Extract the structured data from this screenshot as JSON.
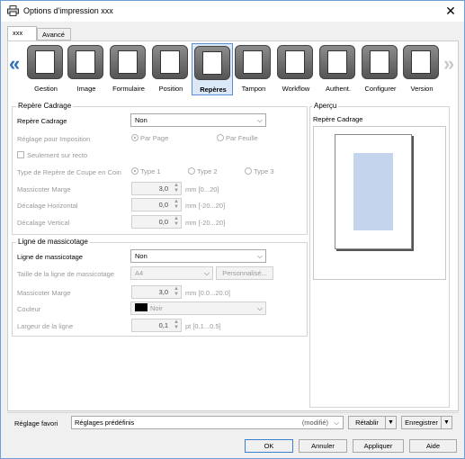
{
  "window": {
    "title": "Options d'impression xxx"
  },
  "tabs": [
    "xxx",
    "Avancé"
  ],
  "ribbon": [
    {
      "label": "Gestion",
      "icon": "gestion-icon"
    },
    {
      "label": "Image",
      "icon": "image-icon"
    },
    {
      "label": "Formulaire",
      "icon": "formulaire-icon"
    },
    {
      "label": "Position",
      "icon": "position-icon"
    },
    {
      "label": "Repères",
      "icon": "reperes-icon",
      "selected": true
    },
    {
      "label": "Tampon",
      "icon": "tampon-icon"
    },
    {
      "label": "Workflow",
      "icon": "workflow-icon"
    },
    {
      "label": "Authent.",
      "icon": "authent-icon"
    },
    {
      "label": "Configurer",
      "icon": "configurer-icon"
    },
    {
      "label": "Version",
      "icon": "version-icon"
    }
  ],
  "repere": {
    "section_title": "Repère Cadrage",
    "repere_label": "Repère Cadrage",
    "repere_value": "Non",
    "imposition_label": "Réglage pour Imposition",
    "par_page": "Par Page",
    "par_feuille": "Par Feuille",
    "recto_label": "Seulement sur recto",
    "coin_label": "Type de Repère de Coupe en Coin",
    "type1": "Type 1",
    "type2": "Type 2",
    "type3": "Type 3",
    "marge_label": "Massicoter Marge",
    "marge_value": "3,0",
    "marge_unit": "mm [0...20]",
    "dh_label": "Décalage Horizontal",
    "dh_value": "0,0",
    "dh_unit": "mm [-20...20]",
    "dv_label": "Décalage Vertical",
    "dv_value": "0,0",
    "dv_unit": "mm [-20...20]"
  },
  "ligne": {
    "section_title": "Ligne de massicotage",
    "ligne_label": "Ligne de massicotage",
    "ligne_value": "Non",
    "taille_label": "Taille de la ligne de massicotage",
    "taille_value": "A4",
    "personnalise": "Personnalisé...",
    "marge_label": "Massicoter Marge",
    "marge_value": "3,0",
    "marge_unit": "mm [0.0...20.0]",
    "couleur_label": "Couleur",
    "couleur_value": "Noir",
    "largeur_label": "Largeur de la ligne",
    "largeur_value": "0,1",
    "largeur_unit": "pt [0.1...0.5]"
  },
  "apercu": {
    "title": "Aperçu",
    "subtitle": "Repère Cadrage"
  },
  "bottom": {
    "favori_label": "Réglage favori",
    "favori_value": "Réglages prédéfinis",
    "favori_state": "(modifié)",
    "retablir": "Rétablir",
    "enregistrer": "Enregistrer",
    "ok": "OK",
    "annuler": "Annuler",
    "appliquer": "Appliquer",
    "aide": "Aide"
  }
}
